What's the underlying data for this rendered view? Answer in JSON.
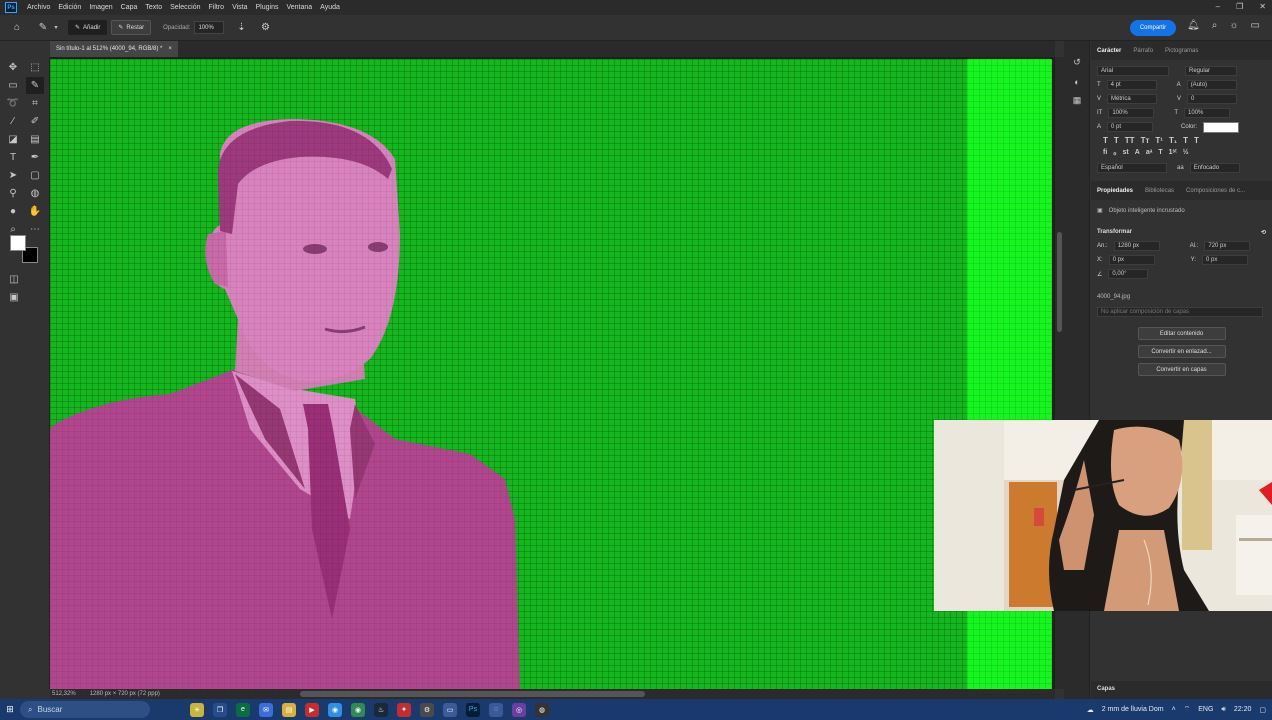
{
  "menubar": {
    "app_logo": "Ps",
    "items": [
      "Archivo",
      "Edición",
      "Imagen",
      "Capa",
      "Texto",
      "Selección",
      "Filtro",
      "Vista",
      "Plugins",
      "Ventana",
      "Ayuda"
    ],
    "window_controls": [
      "–",
      "❐",
      "✕"
    ]
  },
  "options": {
    "add_label": "Añadir",
    "subtract_label": "Restar",
    "opacity_label": "Opacidad:",
    "opacity_value": "100%",
    "share_label": "Compartir"
  },
  "document": {
    "tab_title": "Sin título-1 al 512% (4000_94, RGB/8) *",
    "close_glyph": "×"
  },
  "canvas": {
    "zoom_readout": "512,32%",
    "doc_info": "1280 px × 720 px (72 ppp)",
    "bg_color": "#14b81e",
    "strip_color": "#15f51f",
    "subject_color": "#c4579e"
  },
  "character_panel": {
    "tabs": [
      "Carácter",
      "Párrafo",
      "Pictogramas"
    ],
    "font_family": "Arial",
    "font_style": "Regular",
    "font_size": "4 pt",
    "leading": "(Auto)",
    "kerning": "Métrica",
    "tracking": "0",
    "vertical_scale": "100%",
    "horizontal_scale": "100%",
    "baseline_shift": "0 pt",
    "color_label": "Color:",
    "text_color": "#ffffff",
    "format_buttons": [
      "T",
      "T",
      "TT",
      "Tт",
      "T¹",
      "T₁",
      "T",
      "T"
    ],
    "language": "Español",
    "antialias_icon": "aa",
    "antialias": "Enfocado"
  },
  "properties_panel": {
    "tabs": [
      "Propiedades",
      "Bibliotecas",
      "Composiciones de c..."
    ],
    "object_type": "Objeto inteligente incrustado",
    "transform_title": "Transformar",
    "w_label": "An.:",
    "w_value": "1280 px",
    "h_label": "Al.:",
    "h_value": "720 px",
    "x_label": "X:",
    "x_value": "0 px",
    "y_label": "Y:",
    "y_value": "0 px",
    "angle_value": "0,00°",
    "file_name": "4000_94.jpg",
    "layer_comp": "No aplicar composición de capas",
    "buttons": [
      "Editar contenido",
      "Convertir en enlazad...",
      "Convertir en capas"
    ]
  },
  "layers_panel": {
    "title": "Capas"
  },
  "taskbar": {
    "search_placeholder": "Buscar",
    "weather": "2 mm de lluvia Dom",
    "language": "ENG",
    "time": "22:20"
  }
}
